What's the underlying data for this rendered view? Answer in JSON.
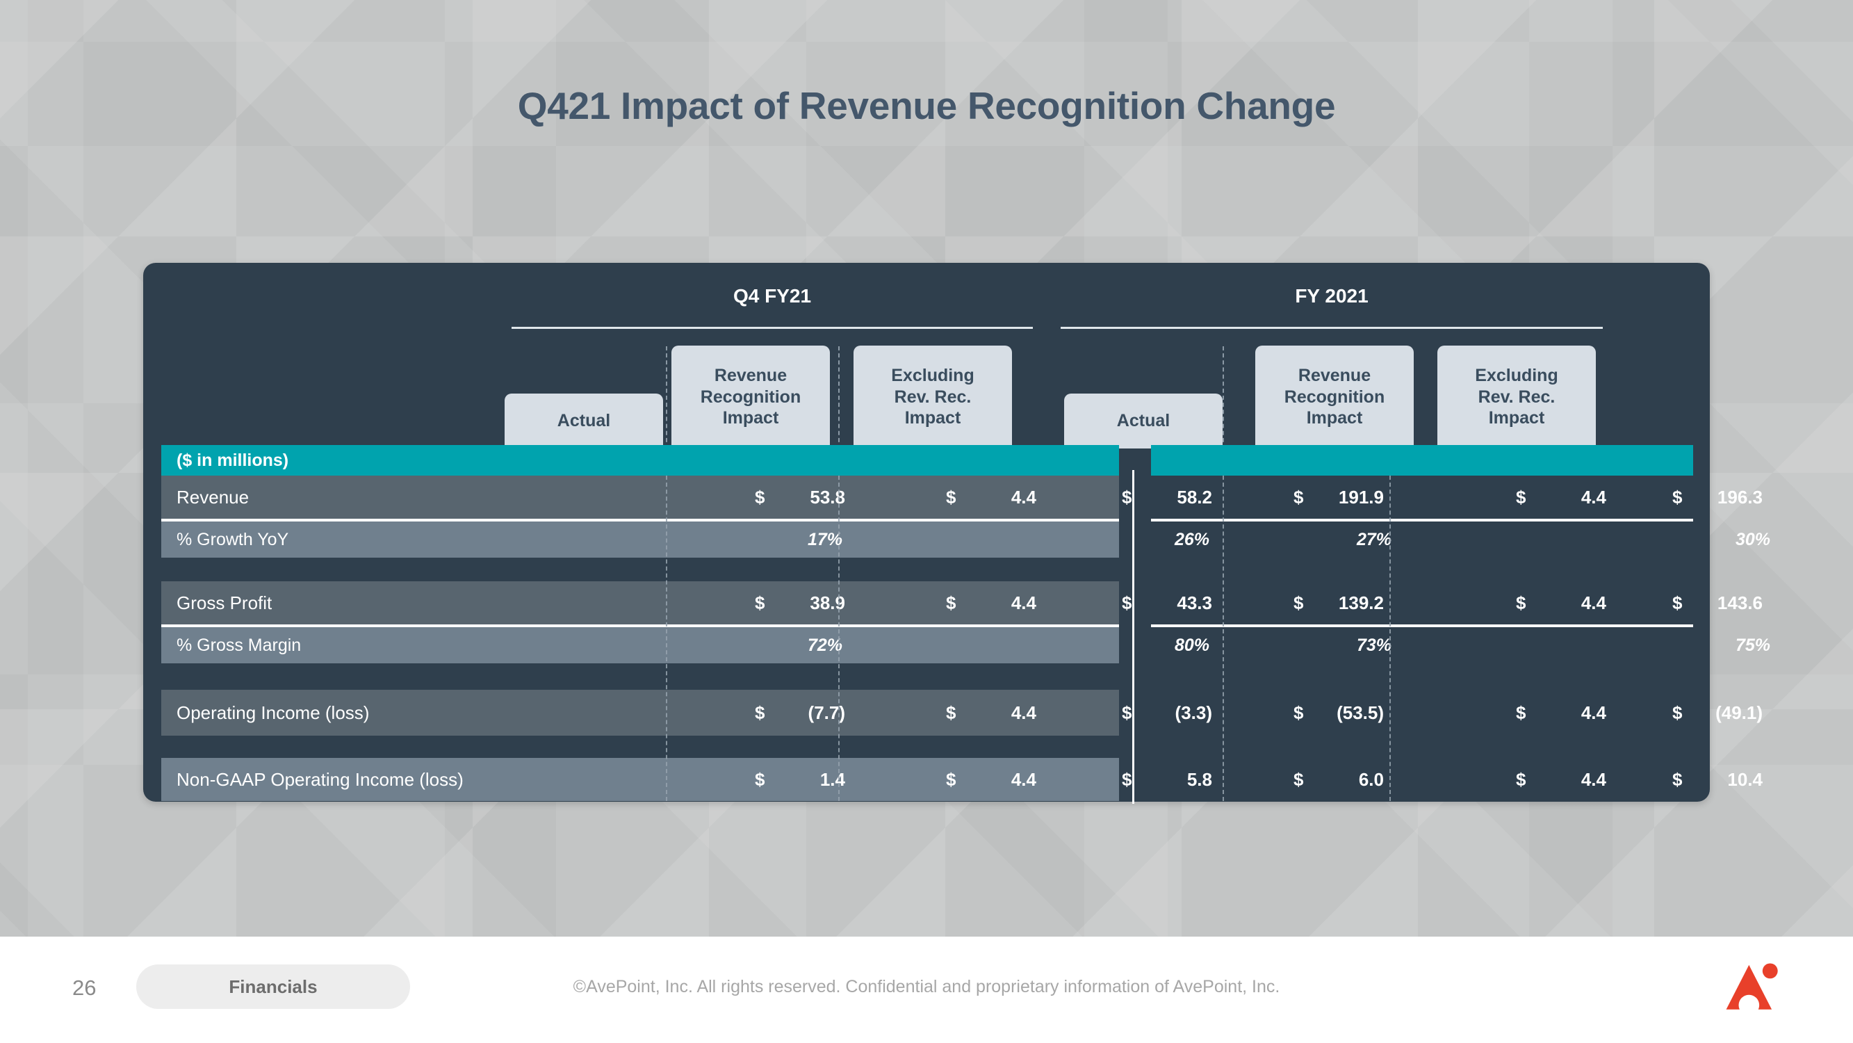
{
  "slide": {
    "title": "Q421 Impact of Revenue Recognition Change",
    "units_banner": "($ in millions)"
  },
  "colors": {
    "background": "#c3c5c5",
    "panel": "#2f3f4d",
    "title": "#44576b",
    "teal": "#00a3ae",
    "row_dark": "#58656f",
    "row_light": "#70808e",
    "header_box": "#d7dee5",
    "header_box_text": "#3a4d5e",
    "logo_red": "#e8402a"
  },
  "groups": [
    {
      "label": "Q4 FY21"
    },
    {
      "label": "FY 2021"
    }
  ],
  "column_headers": [
    {
      "label": "Actual"
    },
    {
      "label": "Revenue\nRecognition\nImpact",
      "line1": "Revenue",
      "line2": "Recognition",
      "line3": "Impact"
    },
    {
      "label": "Excluding\nRev. Rec.\nImpact",
      "line1": "Excluding",
      "line2": "Rev. Rec.",
      "line3": "Impact"
    },
    {
      "label": "Actual"
    },
    {
      "label": "Revenue\nRecognition\nImpact",
      "line1": "Revenue",
      "line2": "Recognition",
      "line3": "Impact"
    },
    {
      "label": "Excluding\nRev. Rec.\nImpact",
      "line1": "Excluding",
      "line2": "Rev. Rec.",
      "line3": "Impact"
    }
  ],
  "rows": [
    {
      "label": "Revenue",
      "type": "currency",
      "q4_actual": "53.8",
      "q4_impact": "4.4",
      "q4_excluding": "58.2",
      "fy_actual": "191.9",
      "fy_impact": "4.4",
      "fy_excluding": "196.3",
      "currency": "$"
    },
    {
      "label": "% Growth YoY",
      "type": "percent",
      "q4_actual": "17%",
      "q4_impact": "",
      "q4_excluding": "26%",
      "fy_actual": "27%",
      "fy_impact": "",
      "fy_excluding": "30%"
    },
    {
      "label": "Gross Profit",
      "type": "currency",
      "q4_actual": "38.9",
      "q4_impact": "4.4",
      "q4_excluding": "43.3",
      "fy_actual": "139.2",
      "fy_impact": "4.4",
      "fy_excluding": "143.6",
      "currency": "$"
    },
    {
      "label": "% Gross Margin",
      "type": "percent",
      "q4_actual": "72%",
      "q4_impact": "",
      "q4_excluding": "80%",
      "fy_actual": "73%",
      "fy_impact": "",
      "fy_excluding": "75%"
    },
    {
      "label": "Operating Income (loss)",
      "type": "currency",
      "q4_actual": "(7.7)",
      "q4_impact": "4.4",
      "q4_excluding": "(3.3)",
      "fy_actual": "(53.5)",
      "fy_impact": "4.4",
      "fy_excluding": "(49.1)",
      "currency": "$"
    },
    {
      "label": "Non-GAAP Operating Income (loss)",
      "type": "currency",
      "q4_actual": "1.4",
      "q4_impact": "4.4",
      "q4_excluding": "5.8",
      "fy_actual": "6.0",
      "fy_impact": "4.4",
      "fy_excluding": "10.4",
      "currency": "$"
    }
  ],
  "footer": {
    "page_number": "26",
    "section_label": "Financials",
    "copyright": "©AvePoint, Inc. All rights reserved. Confidential and proprietary information of AvePoint, Inc.",
    "logo_name": "avepoint-logo"
  },
  "chart_data": {
    "type": "table",
    "title": "Q421 Impact of Revenue Recognition Change",
    "units": "($ in millions)",
    "column_groups": [
      "Q4 FY21",
      "FY 2021"
    ],
    "columns": [
      "Line item",
      "Q4 FY21 Actual",
      "Q4 FY21 Revenue Recognition Impact",
      "Q4 FY21 Excluding Rev. Rec. Impact",
      "FY 2021 Actual",
      "FY 2021 Revenue Recognition Impact",
      "FY 2021 Excluding Rev. Rec. Impact"
    ],
    "rows": [
      [
        "Revenue",
        "$ 53.8",
        "$ 4.4",
        "$ 58.2",
        "$ 191.9",
        "$ 4.4",
        "$ 196.3"
      ],
      [
        "% Growth YoY",
        "17%",
        "",
        "26%",
        "27%",
        "",
        "30%"
      ],
      [
        "Gross Profit",
        "$ 38.9",
        "$ 4.4",
        "$ 43.3",
        "$ 139.2",
        "$ 4.4",
        "$ 143.6"
      ],
      [
        "% Gross Margin",
        "72%",
        "",
        "80%",
        "73%",
        "",
        "75%"
      ],
      [
        "Operating Income (loss)",
        "$ (7.7)",
        "$ 4.4",
        "$ (3.3)",
        "$ (53.5)",
        "$ 4.4",
        "$ (49.1)"
      ],
      [
        "Non-GAAP Operating Income (loss)",
        "$ 1.4",
        "$ 4.4",
        "$ 5.8",
        "$ 6.0",
        "$ 4.4",
        "$ 10.4"
      ]
    ]
  }
}
